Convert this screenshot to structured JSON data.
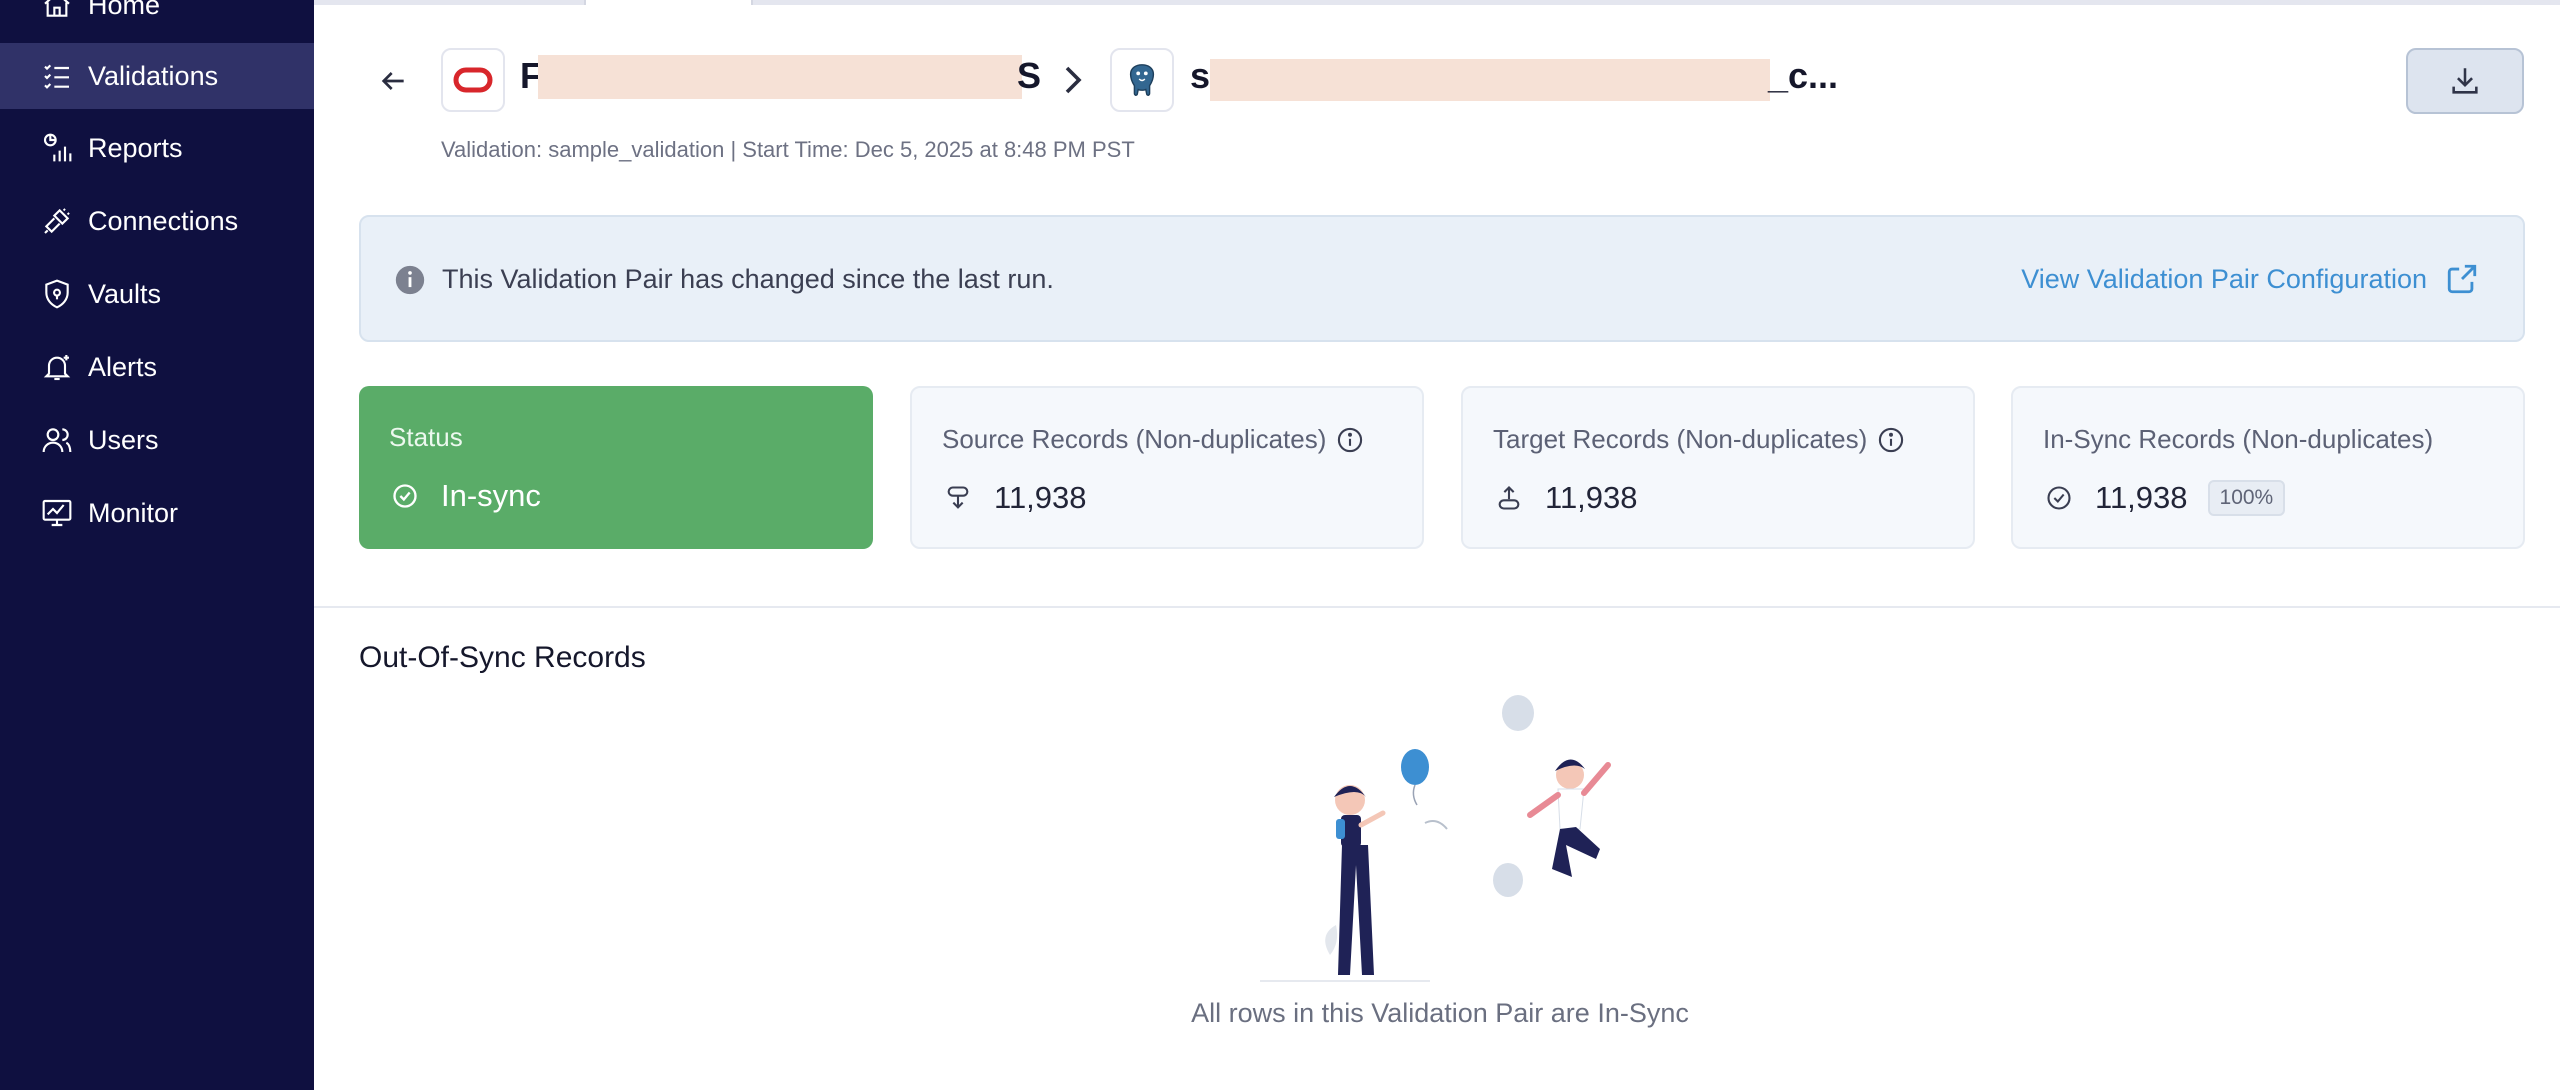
{
  "sidebar": {
    "items": [
      {
        "label": "Home",
        "icon": "home-icon"
      },
      {
        "label": "Validations",
        "icon": "checklist-icon",
        "active": true
      },
      {
        "label": "Reports",
        "icon": "reports-icon"
      },
      {
        "label": "Connections",
        "icon": "plug-icon"
      },
      {
        "label": "Vaults",
        "icon": "shield-icon"
      },
      {
        "label": "Alerts",
        "icon": "bell-icon"
      },
      {
        "label": "Users",
        "icon": "users-icon"
      },
      {
        "label": "Monitor",
        "icon": "monitor-icon"
      }
    ]
  },
  "header": {
    "source_name_start": "F",
    "source_name_end": "S",
    "target_name_start": "s",
    "target_name_end": "_c...",
    "subtitle": "Validation: sample_validation | Start Time: Dec 5, 2025 at 8:48 PM PST",
    "source_icon": "oracle-icon",
    "target_icon": "postgresql-icon"
  },
  "banner": {
    "message": "This Validation Pair has changed since the last run.",
    "link_label": "View Validation Pair Configuration"
  },
  "cards": {
    "status": {
      "label": "Status",
      "value": "In-sync"
    },
    "source": {
      "label": "Source Records (Non-duplicates)",
      "value": "11,938"
    },
    "target": {
      "label": "Target Records (Non-duplicates)",
      "value": "11,938"
    },
    "insync": {
      "label": "In-Sync Records (Non-duplicates)",
      "value": "11,938",
      "percent": "100%"
    }
  },
  "out_of_sync": {
    "title": "Out-Of-Sync Records",
    "empty_message": "All rows in this Validation Pair are In-Sync"
  },
  "colors": {
    "sidebar_bg": "#0f1040",
    "sidebar_active": "#303268",
    "status_green": "#5aac68",
    "link_blue": "#3d8fd2",
    "banner_bg": "#e9f0f8"
  }
}
